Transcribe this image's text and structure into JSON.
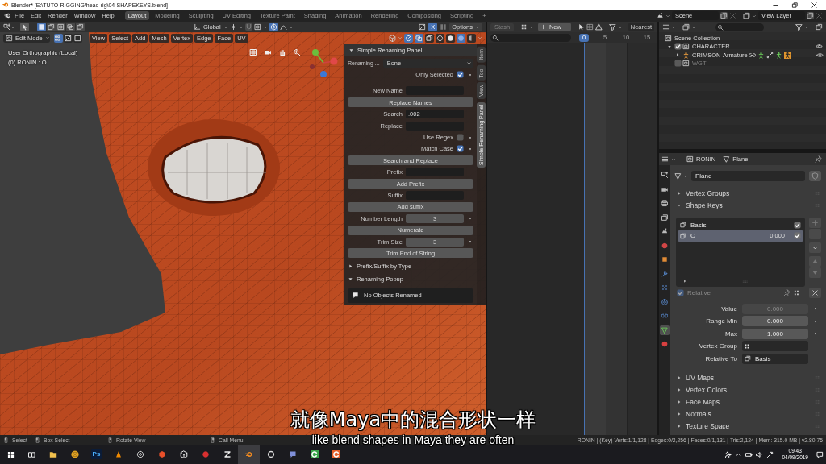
{
  "window": {
    "title": "Blender* [E:\\TUTO-RIGGING\\head-rig\\04-SHAPEKEYS.blend]"
  },
  "menu": [
    "File",
    "Edit",
    "Render",
    "Window",
    "Help"
  ],
  "workspaces": [
    {
      "label": "Layout",
      "selected": true
    },
    {
      "label": "Modeling",
      "selected": false
    },
    {
      "label": "Sculpting",
      "selected": false
    },
    {
      "label": "UV Editing",
      "selected": false
    },
    {
      "label": "Texture Paint",
      "selected": false
    },
    {
      "label": "Shading",
      "selected": false
    },
    {
      "label": "Animation",
      "selected": false
    },
    {
      "label": "Rendering",
      "selected": false
    },
    {
      "label": "Compositing",
      "selected": false
    },
    {
      "label": "Scripting",
      "selected": false
    }
  ],
  "add_workspace": "+",
  "scene_selector": {
    "scene": "Scene",
    "view_layer": "View Layer"
  },
  "viewport": {
    "select_ops": [
      {
        "kind": "set",
        "selected": true
      },
      {
        "kind": "extend",
        "selected": false
      },
      {
        "kind": "subtract",
        "selected": false
      },
      {
        "kind": "invert",
        "selected": false
      },
      {
        "kind": "intersect",
        "selected": false
      }
    ],
    "orientation": "Global",
    "proportional_editing": true,
    "mirror": {
      "label": "X",
      "on": true
    },
    "options": "Options",
    "mode": "Edit Mode",
    "select_modes": [
      {
        "kind": "vertex",
        "selected": true
      },
      {
        "kind": "edge",
        "selected": false
      },
      {
        "kind": "face",
        "selected": false
      }
    ],
    "menus": [
      "View",
      "Select",
      "Add",
      "Mesh",
      "Vertex",
      "Edge",
      "Face",
      "UV"
    ],
    "toggles": [
      {
        "kind": "gizmo",
        "on": true
      },
      {
        "kind": "overlay",
        "on": true
      },
      {
        "kind": "xray",
        "on": false
      }
    ],
    "shading": [
      {
        "kind": "wireframe",
        "selected": false
      },
      {
        "kind": "solid",
        "selected": false
      },
      {
        "kind": "material",
        "selected": true
      },
      {
        "kind": "rendered",
        "selected": false
      }
    ],
    "view_name": "User Orthographic (Local)",
    "object_info": "(0) RONIN : O"
  },
  "sidebar": {
    "panel": {
      "title": "Simple Renaming Panel",
      "expanded": true,
      "rows": [
        {
          "kind": "dropdown",
          "label": "Renaming ...",
          "value": "Bone"
        },
        {
          "kind": "check",
          "label": "Only Selected",
          "checked": true
        },
        {
          "kind": "field",
          "label": "New Name"
        },
        {
          "kind": "button",
          "label": "Replace Names"
        },
        {
          "kind": "field",
          "label": "Search",
          "value": ".002"
        },
        {
          "kind": "field",
          "label": "Replace"
        },
        {
          "kind": "check",
          "label": "Use Regex",
          "checked": false
        },
        {
          "kind": "check",
          "label": "Match Case",
          "checked": true
        },
        {
          "kind": "button",
          "label": "Search and Replace"
        },
        {
          "kind": "field",
          "label": "Prefix"
        },
        {
          "kind": "button",
          "label": "Add Prefix"
        },
        {
          "kind": "field",
          "label": "Suffix"
        },
        {
          "kind": "button",
          "label": "Add suffix"
        },
        {
          "kind": "number",
          "label": "Number Length",
          "value": "3"
        },
        {
          "kind": "button",
          "label": "Numerate"
        },
        {
          "kind": "number",
          "label": "Trim Size",
          "value": "3"
        },
        {
          "kind": "button",
          "label": "Trim End of String"
        }
      ]
    },
    "subpanels": [
      {
        "title": "Prefix/Suffix by Type",
        "expanded": false
      },
      {
        "title": "Renaming Popup",
        "expanded": true
      }
    ],
    "message": "No Objects Renamed",
    "tabs": [
      {
        "label": "Item",
        "selected": false
      },
      {
        "label": "Tool",
        "selected": false
      },
      {
        "label": "View",
        "selected": false
      },
      {
        "label": "Simple Renaming Panel",
        "selected": true
      }
    ]
  },
  "timeline": {
    "stash": {
      "label": "Stash",
      "disabled": true
    },
    "new": "New",
    "snap": "Nearest",
    "frames": [
      {
        "label": "0",
        "selected": true
      },
      {
        "label": "5",
        "selected": false
      },
      {
        "label": "10",
        "selected": false
      },
      {
        "label": "15",
        "selected": false
      }
    ]
  },
  "outliner": {
    "tree": [
      {
        "label": "Scene Collection",
        "kind": "scene",
        "children": [
          {
            "label": "CHARACTER",
            "kind": "collection",
            "checked": true,
            "expanded": true,
            "visible": true,
            "children": [
              {
                "label": "CRIMSON-Armature",
                "kind": "armature",
                "expanded": false,
                "visible": true
              }
            ]
          },
          {
            "label": "WGT",
            "kind": "collection",
            "checked": false,
            "visible": false
          }
        ]
      }
    ]
  },
  "properties": {
    "object": "RONIN",
    "data": "Plane",
    "tabs": [
      {
        "kind": "tool",
        "selected": false
      },
      {
        "kind": "render",
        "selected": false
      },
      {
        "kind": "output",
        "selected": false
      },
      {
        "kind": "view_layer",
        "selected": false
      },
      {
        "kind": "scene",
        "selected": false
      },
      {
        "kind": "world",
        "selected": false
      },
      {
        "kind": "object",
        "selected": false
      },
      {
        "kind": "modifiers",
        "selected": false
      },
      {
        "kind": "particles",
        "selected": false
      },
      {
        "kind": "physics",
        "selected": false
      },
      {
        "kind": "constraints",
        "selected": false
      },
      {
        "kind": "data",
        "selected": true
      },
      {
        "kind": "material",
        "selected": false
      }
    ],
    "datablock": "Plane",
    "panels": [
      {
        "title": "Vertex Groups",
        "expanded": false
      },
      {
        "title": "Shape Keys",
        "expanded": true
      },
      {
        "title": "UV Maps",
        "expanded": false
      },
      {
        "title": "Vertex Colors",
        "expanded": false
      },
      {
        "title": "Face Maps",
        "expanded": false
      },
      {
        "title": "Normals",
        "expanded": false
      },
      {
        "title": "Texture Space",
        "expanded": false
      }
    ],
    "shape_keys": {
      "keys": [
        {
          "name": "Basis",
          "selected": false,
          "checked": true
        },
        {
          "name": "O",
          "value": "0.000",
          "selected": true,
          "checked": true
        }
      ],
      "relative": {
        "label": "Relative",
        "checked": true,
        "disabled": true
      },
      "fields": [
        {
          "kind": "number",
          "label": "Value",
          "value": "0.000",
          "disabled": true
        },
        {
          "kind": "number",
          "label": "Range Min",
          "value": "0.000",
          "disabled": false
        },
        {
          "kind": "number",
          "label": "Max",
          "value": "1.000",
          "disabled": false
        },
        {
          "kind": "group",
          "label": "Vertex Group",
          "disabled": false
        },
        {
          "kind": "key",
          "label": "Relative To",
          "value": "Basis",
          "disabled": false
        }
      ]
    }
  },
  "status_bar": {
    "hints": [
      {
        "kind": "left",
        "label": "Select"
      },
      {
        "kind": "drag",
        "label": "Box Select"
      },
      {
        "kind": "middle",
        "label": "Rotate View"
      },
      {
        "kind": "right",
        "label": "Call Menu"
      }
    ],
    "stats": "RONIN | (Key) Verts:1/1,128 | Edges:0/2,256 | Faces:0/1,131 | Tris:2,124 | Mem: 315.0 MB | v2.80.75"
  },
  "subtitles": {
    "zh": "就像Maya中的混合形状一样",
    "en": "like blend shapes in Maya they are often"
  },
  "taskbar": {
    "apps": [
      {
        "kind": "folder",
        "active": false
      },
      {
        "kind": "chrome",
        "active": false
      },
      {
        "kind": "photoshop",
        "label": "Ps",
        "active": false
      },
      {
        "kind": "cone",
        "active": false
      },
      {
        "kind": "lens",
        "active": false
      },
      {
        "kind": "gem",
        "active": false
      },
      {
        "kind": "cube",
        "active": false
      },
      {
        "kind": "red",
        "active": false
      },
      {
        "kind": "zig",
        "active": false
      },
      {
        "kind": "blender",
        "active": true
      },
      {
        "kind": "ring",
        "active": false
      },
      {
        "kind": "chat",
        "active": false
      },
      {
        "kind": "green",
        "active": false
      },
      {
        "kind": "orange",
        "active": false
      }
    ],
    "time": "09:43",
    "date": "04/09/2019"
  }
}
